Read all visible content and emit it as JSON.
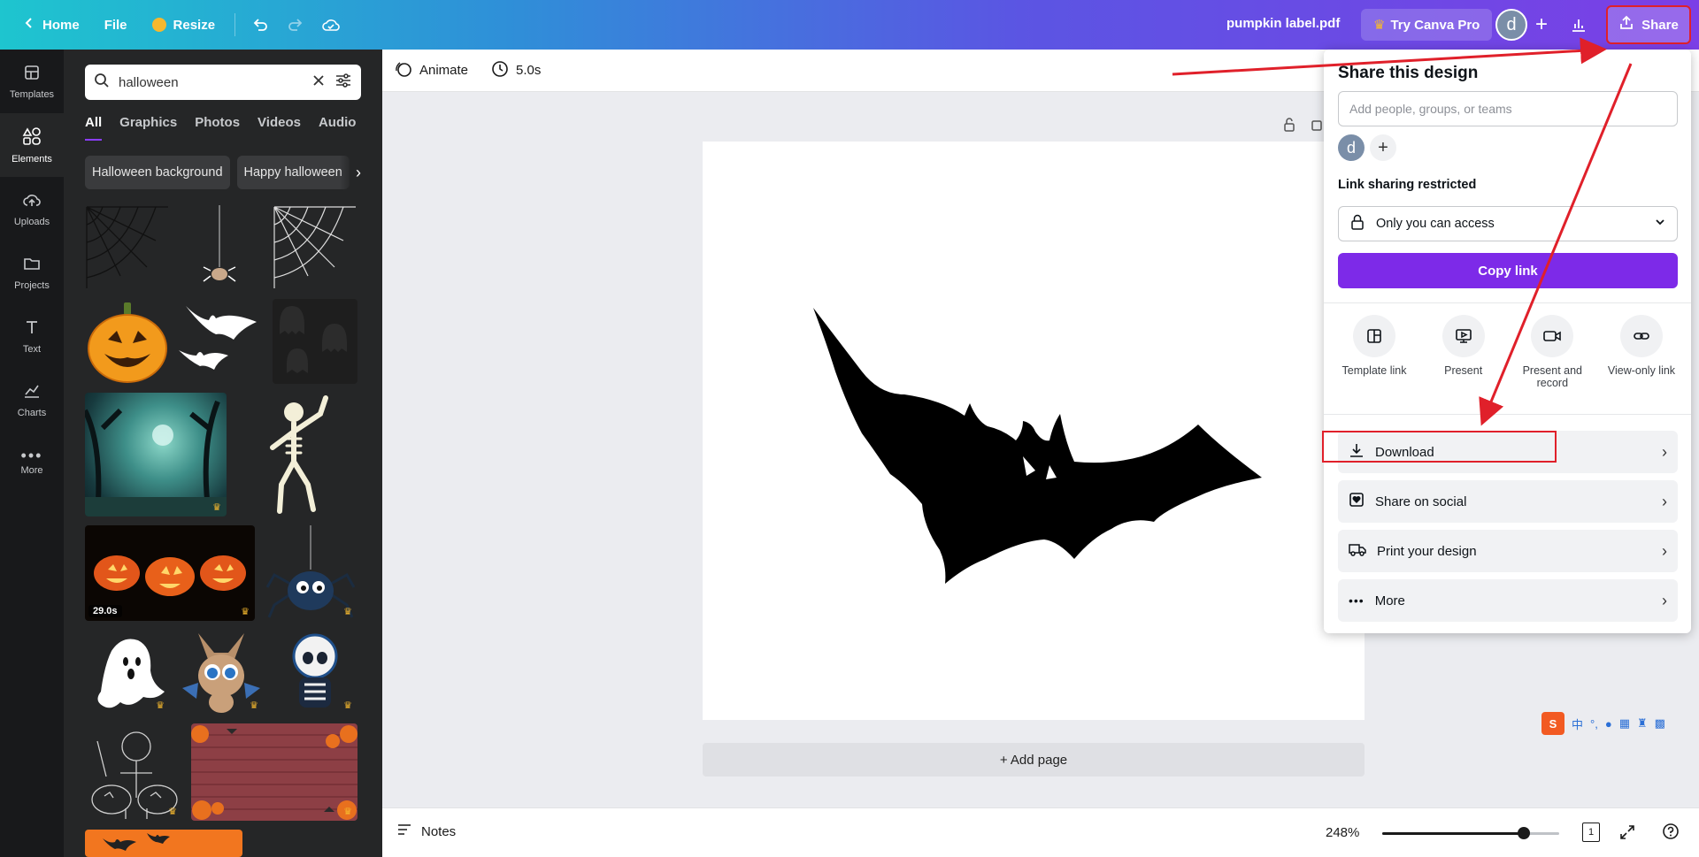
{
  "topbar": {
    "home_label": "Home",
    "file_label": "File",
    "resize_label": "Resize",
    "doc_title": "pumpkin label.pdf",
    "try_pro_label": "Try Canva Pro",
    "avatar_initial": "d",
    "share_label": "Share"
  },
  "rail": {
    "items": [
      {
        "label": "Templates",
        "icon": "templates-icon"
      },
      {
        "label": "Elements",
        "icon": "elements-icon",
        "active": true
      },
      {
        "label": "Uploads",
        "icon": "uploads-icon"
      },
      {
        "label": "Projects",
        "icon": "projects-icon"
      },
      {
        "label": "Text",
        "icon": "text-icon"
      },
      {
        "label": "Charts",
        "icon": "charts-icon"
      },
      {
        "label": "More",
        "icon": "more-icon"
      }
    ]
  },
  "panel": {
    "search_value": "halloween",
    "tabs": [
      "All",
      "Graphics",
      "Photos",
      "Videos",
      "Audio"
    ],
    "chips": [
      "Halloween background",
      "Happy halloween"
    ],
    "video_badge": "29.0s"
  },
  "toolbar": {
    "animate_label": "Animate",
    "duration_label": "5.0s"
  },
  "canvas": {
    "add_page_label": "+ Add page"
  },
  "bottombar": {
    "notes_label": "Notes",
    "zoom_label": "248%",
    "zoom_level_fraction": 0.8,
    "page_count": "1"
  },
  "share_panel": {
    "title": "Share this design",
    "input_placeholder": "Add people, groups, or teams",
    "avatar_initial": "d",
    "link_label": "Link sharing restricted",
    "access_value": "Only you can access",
    "copy_label": "Copy link",
    "options": [
      {
        "label": "Template link",
        "icon": "template-link-icon"
      },
      {
        "label": "Present",
        "icon": "present-icon"
      },
      {
        "label": "Present and record",
        "icon": "record-icon"
      },
      {
        "label": "View-only link",
        "icon": "link-icon"
      }
    ],
    "rows": [
      {
        "label": "Download",
        "icon": "download-icon"
      },
      {
        "label": "Share on social",
        "icon": "heart-icon"
      },
      {
        "label": "Print your design",
        "icon": "truck-icon"
      },
      {
        "label": "More",
        "icon": "more-dots-icon"
      }
    ]
  },
  "colors": {
    "accent": "#7d2ae8",
    "annotation_red": "#e0202a",
    "panel_dark": "#252627"
  },
  "ime": {
    "logo": "S",
    "text": "中"
  }
}
